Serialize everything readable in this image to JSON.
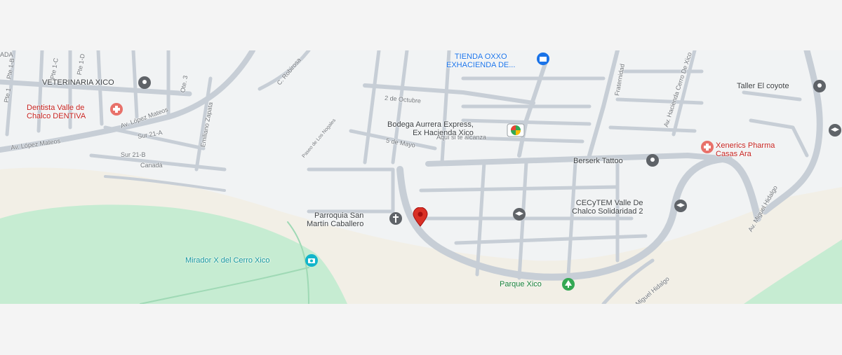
{
  "map": {
    "places": {
      "tienda_oxxo": "TIENDA OXXO\nEXHACIENDA DE...",
      "veterinaria": "VETERINARIA XICO",
      "dentista": "Dentista Valle de\nChalco DENTIVA",
      "bodega_aurrera": "Bodega Aurrera Express,\nEx Hacienda Xico",
      "bodega_sub": "Aquí si te alcanza",
      "taller": "Taller El coyote",
      "xenerics": "Xenerics Pharma\nCasas Ara",
      "berserk": "Berserk Tattoo",
      "cecytem": "CECyTEM Valle De\nChalco Solidaridad 2",
      "parroquia": "Parroquia San\nMartín Caballero",
      "mirador": "Mirador X del Cerro Xico",
      "parque": "Parque Xico"
    },
    "streets": {
      "av_lopez_1": "Av. López Mateos",
      "av_lopez_2": "Av. López Mateos",
      "sur_21a": "Sur 21-A",
      "sur_21b": "Sur 21-B",
      "canada": "Canadá",
      "emiliano": "Emiliano Zapata",
      "robirosa": "C. Robirosa",
      "oct2": "2 de Octubre",
      "may5": "5 de Mayo",
      "fraternidad": "Fraternidad",
      "av_hacienda": "Av. Hacienda Cerro De Xico",
      "av_hidalgo": "Av. Miguel Hidalgo",
      "hidalgo_bottom": "Miguel Hidalgo",
      "pte1b": "Pte 1-B",
      "pte1c": "Pte 1-C",
      "pte1d": "Pte 1-D",
      "pte1": "Pte 1",
      "ote3": "Ote. 3",
      "ada": "ADA",
      "paseo": "Paseo de Los Nogales"
    },
    "icons": {
      "red_pin": "location-pin",
      "shop": "store-icon",
      "pet": "pin-icon",
      "dentist": "hospital-icon",
      "school": "school-icon",
      "park": "tree-icon",
      "camera": "camera-icon",
      "church": "cross-icon"
    },
    "colors": {
      "road": "#c7ced6",
      "land": "#f1f3f4",
      "hill": "#c6ecd2",
      "sand": "#f2efe6",
      "pin_red": "#d93025"
    }
  }
}
